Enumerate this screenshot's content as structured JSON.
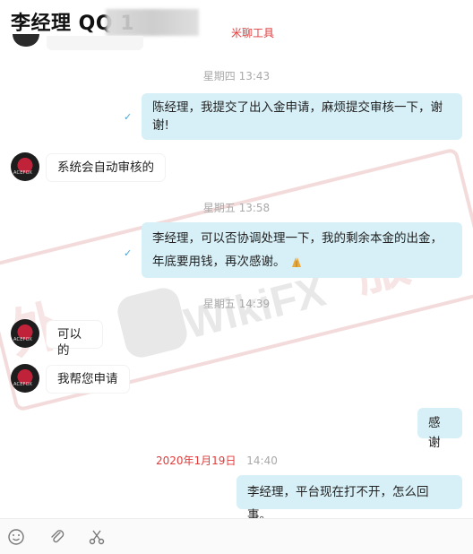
{
  "header": {
    "title": "李经理 QQ 1",
    "tag": "米聊工具"
  },
  "messages": [
    {
      "timestamp": "星期四 13:43"
    },
    {
      "direction": "out",
      "text": "陈经理，我提交了出入金申请，麻烦提交审核一下，谢谢!"
    },
    {
      "direction": "in",
      "text": "系统会自动审核的"
    },
    {
      "timestamp": "星期五 13:58"
    },
    {
      "direction": "out",
      "text": "李经理，可以否协调处理一下，我的剩余本金的出金，年底要用钱，再次感谢。"
    },
    {
      "timestamp": "星期五 14:39"
    },
    {
      "direction": "in",
      "text": "可以的"
    },
    {
      "direction": "in",
      "text": "我帮您申请"
    },
    {
      "direction": "out",
      "text": "感谢"
    },
    {
      "date": "2020年1月19日",
      "time": "14:40"
    },
    {
      "direction": "out",
      "text": "李经理，平台现在打不开，怎么回事。"
    }
  ],
  "toolbar": {
    "icons": [
      "emoji-icon",
      "attachment-icon",
      "scissors-icon"
    ]
  },
  "watermark": {
    "brand": "WikiFX"
  },
  "colors": {
    "outgoing_bubble": "#d7f0f7",
    "incoming_bubble": "#ffffff",
    "accent_red": "#e23a3a"
  }
}
